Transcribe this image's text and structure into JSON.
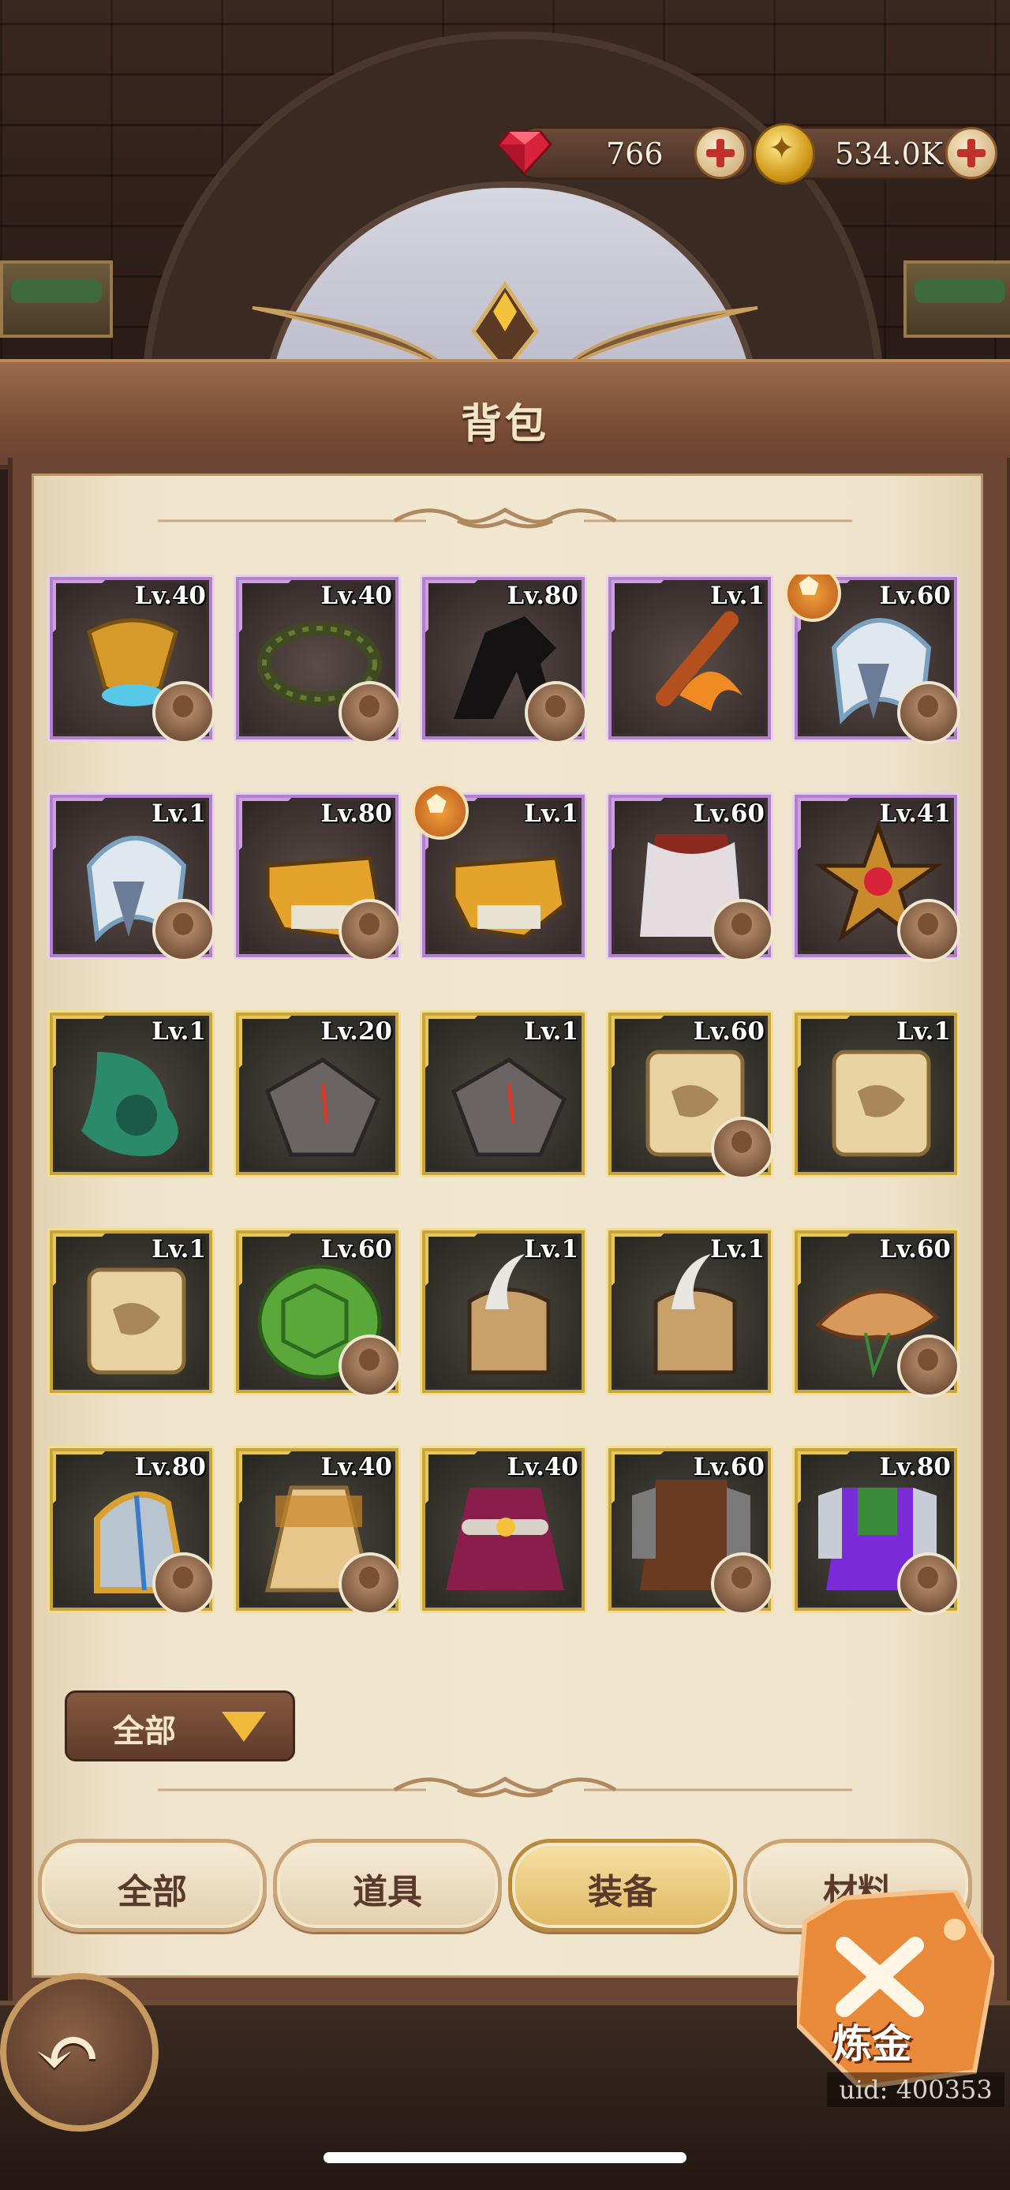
{
  "currency": {
    "gems": "766",
    "gold": "534.0K"
  },
  "title": "背包",
  "items": [
    {
      "level": "Lv.40",
      "rarity": "purple",
      "art": "golden-cup",
      "hero": true
    },
    {
      "level": "Lv.40",
      "rarity": "purple",
      "art": "thorn-crown",
      "hero": true
    },
    {
      "level": "Lv.80",
      "rarity": "purple",
      "art": "dark-horse",
      "hero": true
    },
    {
      "level": "Lv.1",
      "rarity": "purple",
      "art": "flame-flute",
      "hero": false
    },
    {
      "level": "Lv.60",
      "rarity": "purple",
      "art": "fur-hood",
      "hero": true,
      "badge": true
    },
    {
      "level": "Lv.1",
      "rarity": "purple",
      "art": "fur-hood",
      "hero": true
    },
    {
      "level": "Lv.80",
      "rarity": "purple",
      "art": "skull-mask",
      "hero": true
    },
    {
      "level": "Lv.1",
      "rarity": "purple",
      "art": "skull-mask",
      "hero": false,
      "badge": true
    },
    {
      "level": "Lv.60",
      "rarity": "purple",
      "art": "fur-vest",
      "hero": true
    },
    {
      "level": "Lv.41",
      "rarity": "purple",
      "art": "star-amulet",
      "hero": true
    },
    {
      "level": "Lv.1",
      "rarity": "gold",
      "art": "green-cloak",
      "hero": false
    },
    {
      "level": "Lv.20",
      "rarity": "gold",
      "art": "stone-gauntlet",
      "hero": false
    },
    {
      "level": "Lv.1",
      "rarity": "gold",
      "art": "stone-gauntlet",
      "hero": false
    },
    {
      "level": "Lv.60",
      "rarity": "gold",
      "art": "map-scroll",
      "hero": true
    },
    {
      "level": "Lv.1",
      "rarity": "gold",
      "art": "map-scroll",
      "hero": false
    },
    {
      "level": "Lv.1",
      "rarity": "gold",
      "art": "map-scroll",
      "hero": false
    },
    {
      "level": "Lv.60",
      "rarity": "gold",
      "art": "turtle-shell",
      "hero": true
    },
    {
      "level": "Lv.1",
      "rarity": "gold",
      "art": "horn-helmet",
      "hero": false
    },
    {
      "level": "Lv.1",
      "rarity": "gold",
      "art": "horn-helmet",
      "hero": false
    },
    {
      "level": "Lv.60",
      "rarity": "gold",
      "art": "straw-hat",
      "hero": true
    },
    {
      "level": "Lv.80",
      "rarity": "gold",
      "art": "steel-helm",
      "hero": true
    },
    {
      "level": "Lv.40",
      "rarity": "gold",
      "art": "cloth-robe",
      "hero": true
    },
    {
      "level": "Lv.40",
      "rarity": "gold",
      "art": "crimson-cape",
      "hero": false
    },
    {
      "level": "Lv.60",
      "rarity": "gold",
      "art": "leather-armor",
      "hero": true
    },
    {
      "level": "Lv.80",
      "rarity": "gold",
      "art": "purple-armor",
      "hero": true
    }
  ],
  "filter": {
    "label": "全部"
  },
  "tabs": [
    {
      "label": "全部",
      "active": false
    },
    {
      "label": "道具",
      "active": false
    },
    {
      "label": "装备",
      "active": true
    },
    {
      "label": "材料",
      "active": false
    }
  ],
  "alchemy": {
    "label": "炼金"
  },
  "uid": "uid: 400353",
  "colors": {
    "purple_frame": "#b57fd0",
    "gold_frame": "#c8a43a",
    "parchment": "#f1e6cf",
    "title_bar": "#7a4e36",
    "accent_orange": "#e98a3a"
  }
}
